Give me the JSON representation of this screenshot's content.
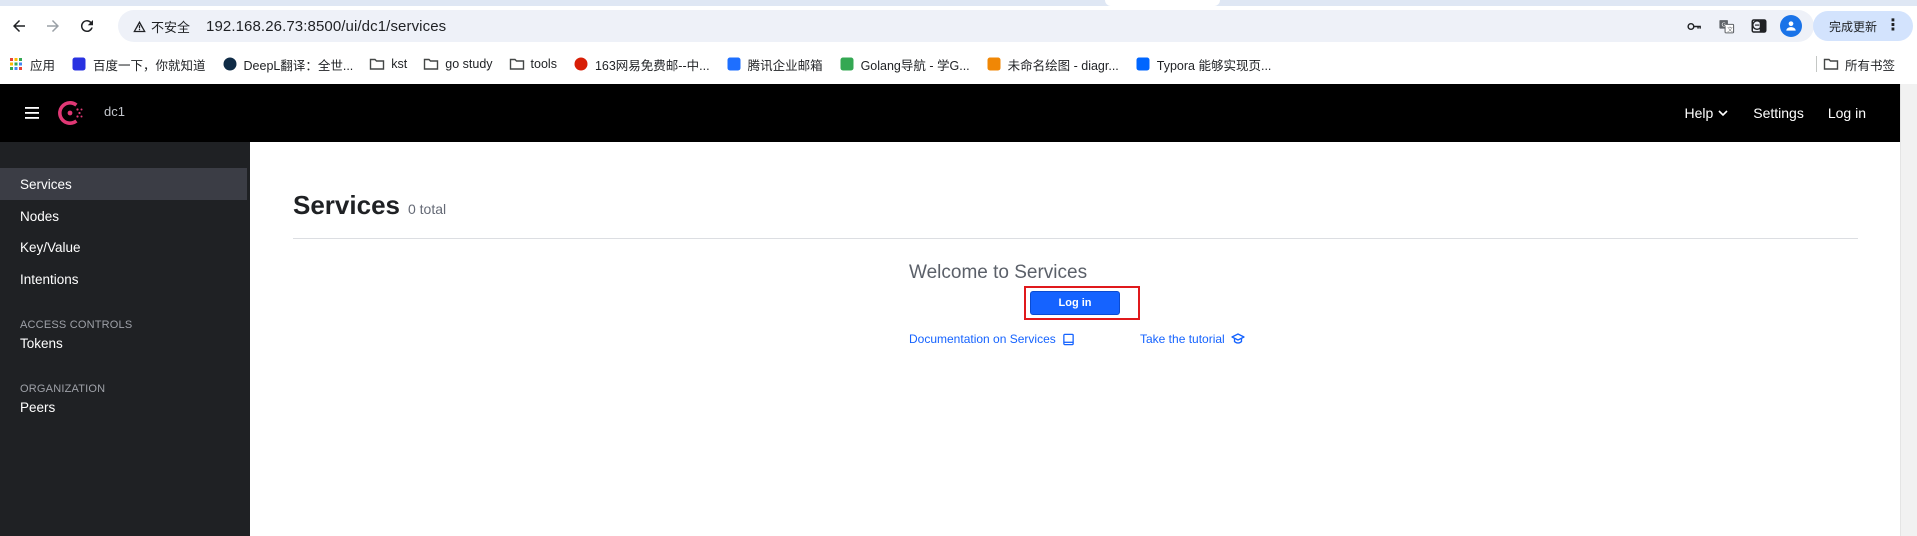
{
  "browser": {
    "security_label": "不安全",
    "url": "192.168.26.73:8500/ui/dc1/services",
    "update_button": "完成更新",
    "bookmarks": [
      {
        "label": "应用",
        "icon": "apps-grid-icon",
        "color": "#ea4335"
      },
      {
        "label": "百度一下，你就知道",
        "icon": "baidu-icon",
        "color": "#2932e1"
      },
      {
        "label": "DeepL翻译：全世...",
        "icon": "deepl-icon",
        "color": "#0f2b46"
      },
      {
        "label": "kst",
        "icon": "folder-icon",
        "color": "#444746"
      },
      {
        "label": "go study",
        "icon": "folder-icon",
        "color": "#444746"
      },
      {
        "label": "tools",
        "icon": "folder-icon",
        "color": "#444746"
      },
      {
        "label": "163网易免费邮--中...",
        "icon": "netease-icon",
        "color": "#d81e06"
      },
      {
        "label": "腾讯企业邮箱",
        "icon": "tencent-mail-icon",
        "color": "#1e6fff"
      },
      {
        "label": "Golang导航 - 学G...",
        "icon": "golang-nav-icon",
        "color": "#34a853"
      },
      {
        "label": "未命名绘图 - diagr...",
        "icon": "drawio-icon",
        "color": "#f08705"
      },
      {
        "label": "Typora 能够实现页...",
        "icon": "zhihu-icon",
        "color": "#0066ff"
      }
    ],
    "all_bookmarks": "所有书签"
  },
  "app": {
    "datacenter": "dc1",
    "header_nav": {
      "help": "Help",
      "settings": "Settings",
      "login": "Log in"
    },
    "sidebar": {
      "items": [
        {
          "label": "Services",
          "active": true
        },
        {
          "label": "Nodes"
        },
        {
          "label": "Key/Value"
        },
        {
          "label": "Intentions"
        }
      ],
      "access_heading": "ACCESS CONTROLS",
      "access_items": [
        {
          "label": "Tokens"
        }
      ],
      "org_heading": "ORGANIZATION",
      "org_items": [
        {
          "label": "Peers"
        }
      ]
    },
    "main": {
      "title": "Services",
      "count": "0 total",
      "empty_title": "Welcome to Services",
      "login_button": "Log in",
      "doc_link": "Documentation on Services",
      "tutorial_link": "Take the tutorial"
    }
  },
  "colors": {
    "header_bg": "#000000",
    "sidebar_bg": "#1f2124",
    "primary_blue": "#1563ff",
    "consul_pink": "#e03875",
    "highlight_red": "#e0191c"
  }
}
